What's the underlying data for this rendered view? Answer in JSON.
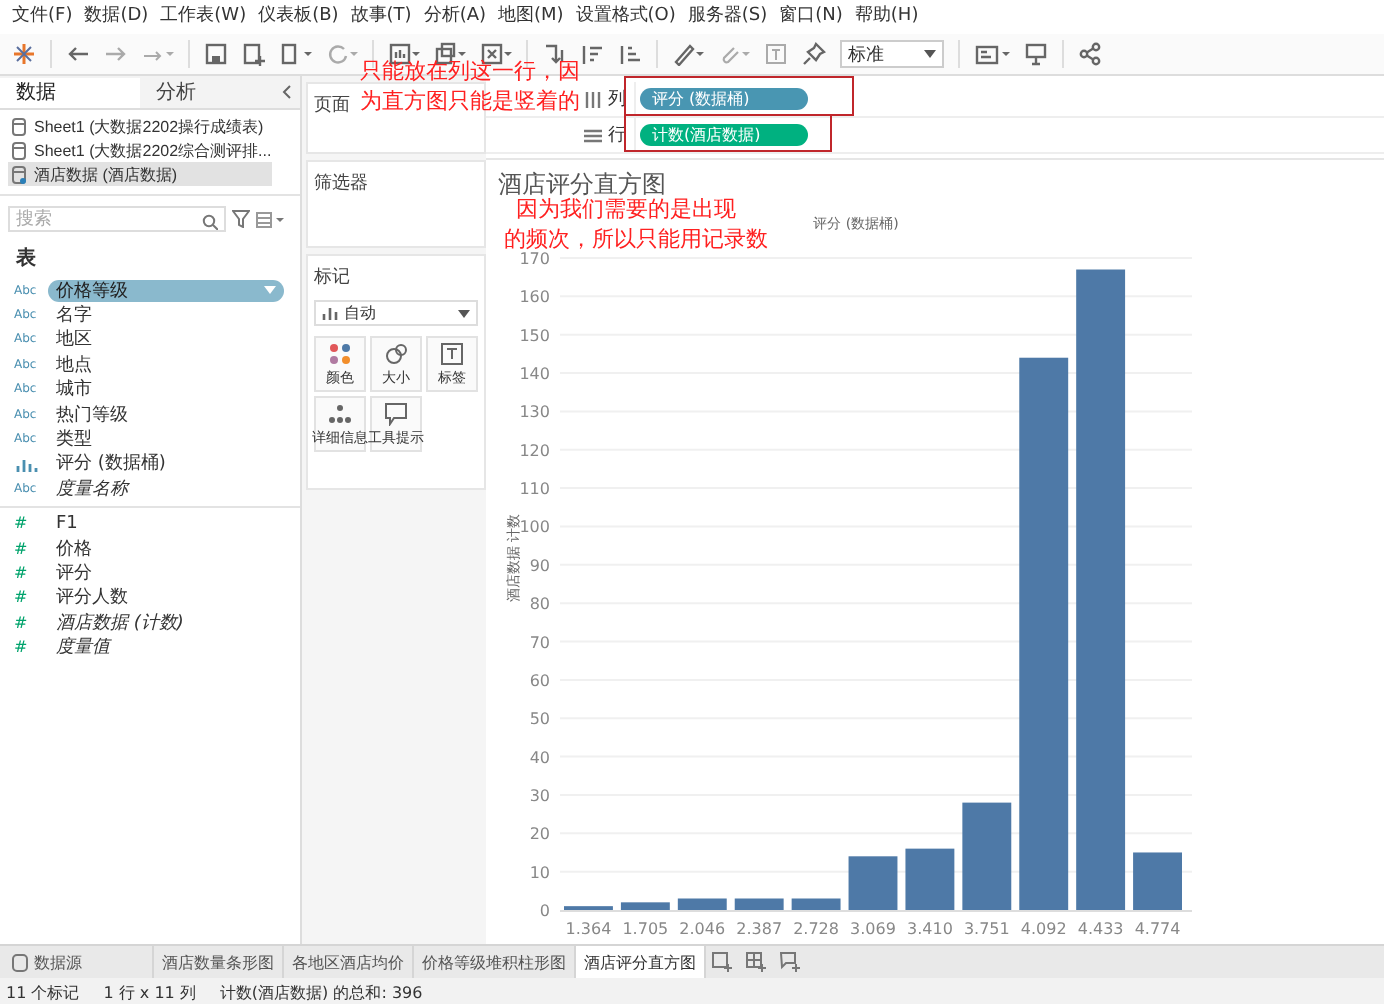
{
  "menu": [
    "文件(F)",
    "数据(D)",
    "工作表(W)",
    "仪表板(B)",
    "故事(T)",
    "分析(A)",
    "地图(M)",
    "设置格式(O)",
    "服务器(S)",
    "窗口(N)",
    "帮助(H)"
  ],
  "toolbar": {
    "fit_dropdown": "标准"
  },
  "left_panel": {
    "tabs": [
      {
        "label": "数据",
        "selected": true
      },
      {
        "label": "分析",
        "selected": false
      }
    ],
    "sources": [
      {
        "label": "Sheet1 (大数据2202操行成绩表)",
        "selected": false
      },
      {
        "label": "Sheet1 (大数据2202综合测评排...",
        "selected": false
      },
      {
        "label": "酒店数据 (酒店数据)",
        "selected": true
      }
    ],
    "search": {
      "placeholder": "搜索"
    },
    "section": "表",
    "fields": [
      {
        "name": "价格等级",
        "kind": "dimension",
        "icon_text": "Abc",
        "selected": true,
        "generated": false
      },
      {
        "name": "名字",
        "kind": "dimension",
        "icon_text": "Abc",
        "selected": false,
        "generated": false
      },
      {
        "name": "地区",
        "kind": "dimension",
        "icon_text": "Abc",
        "selected": false,
        "generated": false
      },
      {
        "name": "地点",
        "kind": "dimension",
        "icon_text": "Abc",
        "selected": false,
        "generated": false
      },
      {
        "name": "城市",
        "kind": "dimension",
        "icon_text": "Abc",
        "selected": false,
        "generated": false
      },
      {
        "name": "热门等级",
        "kind": "dimension",
        "icon_text": "Abc",
        "selected": false,
        "generated": false
      },
      {
        "name": "类型",
        "kind": "dimension",
        "icon_text": "Abc",
        "selected": false,
        "generated": false
      },
      {
        "name": "评分 (数据桶)",
        "kind": "bin",
        "selected": false,
        "generated": false
      },
      {
        "name": "度量名称",
        "kind": "dimension",
        "icon_text": "Abc",
        "selected": false,
        "generated": true
      },
      {
        "name": "F1",
        "kind": "measure",
        "icon_text": "#",
        "selected": false,
        "generated": false
      },
      {
        "name": "价格",
        "kind": "measure",
        "icon_text": "#",
        "selected": false,
        "generated": false
      },
      {
        "name": "评分",
        "kind": "measure",
        "icon_text": "#",
        "selected": false,
        "generated": false
      },
      {
        "name": "评分人数",
        "kind": "measure",
        "icon_text": "#",
        "selected": false,
        "generated": false
      },
      {
        "name": "酒店数据 (计数)",
        "kind": "measure",
        "icon_text": "#",
        "selected": false,
        "generated": true
      },
      {
        "name": "度量值",
        "kind": "measure",
        "icon_text": "#",
        "selected": false,
        "generated": true
      }
    ]
  },
  "cards": {
    "pages": "页面",
    "filters": "筛选器",
    "marks": {
      "title": "标记",
      "mark_type": "自动",
      "buttons": [
        {
          "label": "颜色",
          "kind": "color"
        },
        {
          "label": "大小",
          "kind": "size"
        },
        {
          "label": "标签",
          "kind": "label"
        },
        {
          "label": "详细信息",
          "kind": "detail"
        },
        {
          "label": "工具提示",
          "kind": "tooltip"
        }
      ]
    }
  },
  "shelves": [
    {
      "label": "列",
      "kind": "columns",
      "pill": "评分 (数据桶)",
      "color": "#4996b2"
    },
    {
      "label": "行",
      "kind": "rows",
      "pill": "计数(酒店数据)",
      "color": "#00b180"
    }
  ],
  "view": {
    "title": "酒店评分直方图",
    "chart_data": {
      "type": "bar",
      "xlabel": "评分 (数据桶)",
      "ylabel": "酒店数据 计数",
      "categories": [
        "1.364",
        "1.705",
        "2.046",
        "2.387",
        "2.728",
        "3.069",
        "3.410",
        "3.751",
        "4.092",
        "4.433",
        "4.774"
      ],
      "series": [
        {
          "color": "#4e79a7",
          "values": [
            1,
            2,
            3,
            3,
            3,
            14,
            16,
            28,
            144,
            167,
            15
          ]
        }
      ],
      "grid": true,
      "ylim": [
        0,
        170
      ],
      "yticks": [
        0,
        10,
        20,
        30,
        40,
        50,
        60,
        70,
        80,
        90,
        100,
        110,
        120,
        130,
        140,
        150,
        160,
        170
      ]
    }
  },
  "annotations": [
    {
      "lines": [
        "只能放在列这一行，因",
        "为直方图只能是竖着的"
      ]
    },
    {
      "lines": [
        "因为我们需要的是出现",
        "的频次，所以只能用记录数"
      ]
    }
  ],
  "sheet_tabs": [
    {
      "label": "数据源",
      "kind": "datasource",
      "selected": false
    },
    {
      "label": "酒店数量条形图",
      "kind": "sheet",
      "selected": false
    },
    {
      "label": "各地区酒店均价",
      "kind": "sheet",
      "selected": false
    },
    {
      "label": "价格等级堆积柱形图",
      "kind": "sheet",
      "selected": false
    },
    {
      "label": "酒店评分直方图",
      "kind": "sheet",
      "selected": true
    }
  ],
  "status_bar": [
    "11 个标记",
    "1 行 x 11 列",
    "计数(酒店数据) 的总和: 396"
  ]
}
